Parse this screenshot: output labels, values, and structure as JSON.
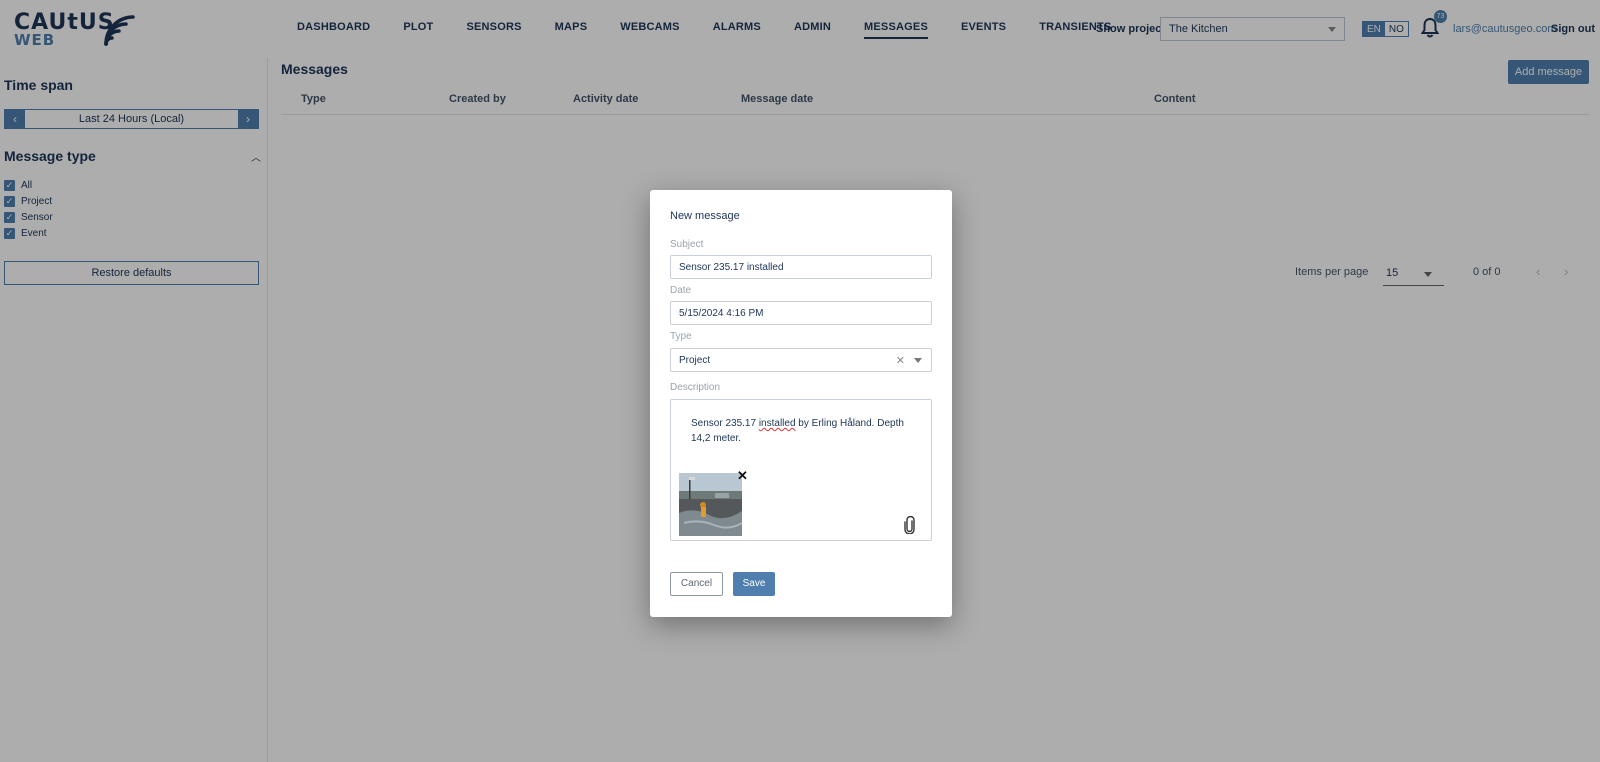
{
  "app": {
    "logo_line1": "CAUtUS",
    "logo_line2": "WEB"
  },
  "nav": {
    "items": [
      {
        "label": "DASHBOARD"
      },
      {
        "label": "PLOT"
      },
      {
        "label": "SENSORS"
      },
      {
        "label": "MAPS"
      },
      {
        "label": "WEBCAMS"
      },
      {
        "label": "ALARMS"
      },
      {
        "label": "ADMIN"
      },
      {
        "label": "MESSAGES",
        "active": true
      },
      {
        "label": "EVENTS"
      },
      {
        "label": "TRANSIENTS"
      }
    ]
  },
  "header": {
    "show_project_label": "Show project:",
    "project_value": "The Kitchen",
    "lang_en": "EN",
    "lang_no": "NO",
    "notification_count": "73",
    "user_email": "lars@cautusgeo.com",
    "sign_out": "Sign out"
  },
  "sidebar": {
    "time_span_title": "Time span",
    "time_span_value": "Last 24 Hours (Local)",
    "prev_arrow": "‹",
    "next_arrow": "›",
    "message_type_title": "Message type",
    "checkboxes": [
      {
        "label": "All",
        "checked": true
      },
      {
        "label": "Project",
        "checked": true
      },
      {
        "label": "Sensor",
        "checked": true
      },
      {
        "label": "Event",
        "checked": true
      }
    ],
    "restore_defaults": "Restore defaults"
  },
  "main": {
    "title": "Messages",
    "add_message": "Add message",
    "columns": [
      "Type",
      "Created by",
      "Activity date",
      "Message date",
      "Content"
    ],
    "pager": {
      "items_per_page_label": "Items per page",
      "items_per_page_value": "15",
      "range": "0 of 0"
    }
  },
  "modal": {
    "title": "New message",
    "subject_label": "Subject",
    "subject_value": "Sensor 235.17 installed",
    "date_label": "Date",
    "date_value": "5/15/2024 4:16 PM",
    "type_label": "Type",
    "type_value": "Project",
    "description_label": "Description",
    "description_part1": "Sensor 235.17 ",
    "description_misspelled": "installed",
    "description_part2": " by Erling Håland.  Depth 14,2 meter.",
    "cancel": "Cancel",
    "save": "Save"
  },
  "colors": {
    "brand_navy": "#1d3557",
    "accent_blue": "#4f7fae"
  }
}
